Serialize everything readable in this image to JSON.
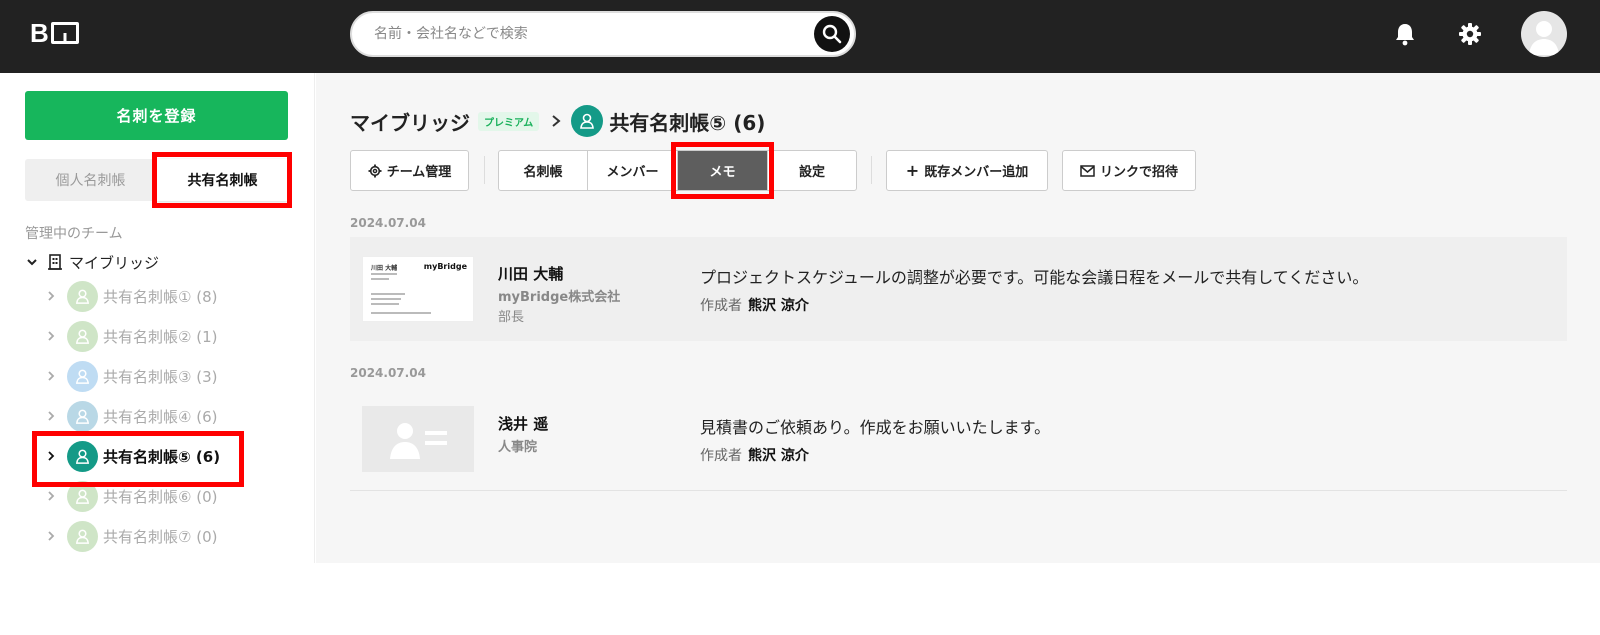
{
  "header": {
    "logo": "B",
    "search_placeholder": "名前・会社名などで検索"
  },
  "sidebar": {
    "register_label": "名刺を登録",
    "tabs": [
      {
        "label": "個人名刺帳",
        "active": false
      },
      {
        "label": "共有名刺帳",
        "active": true
      }
    ],
    "section_label": "管理中のチーム",
    "root_label": "マイブリッジ",
    "teams": [
      {
        "label": "共有名刺帳① (8)",
        "color": "#cfe5c7",
        "active": false
      },
      {
        "label": "共有名刺帳② (1)",
        "color": "#cfe5c7",
        "active": false
      },
      {
        "label": "共有名刺帳③ (3)",
        "color": "#bfdcf3",
        "active": false
      },
      {
        "label": "共有名刺帳④ (6)",
        "color": "#b9d8e6",
        "active": false
      },
      {
        "label": "共有名刺帳⑤ (6)",
        "color": "#149a87",
        "active": true
      },
      {
        "label": "共有名刺帳⑥ (0)",
        "color": "#cfe5c7",
        "active": false
      },
      {
        "label": "共有名刺帳⑦ (0)",
        "color": "#cfe5c7",
        "active": false
      }
    ]
  },
  "main": {
    "breadcrumb_root": "マイブリッジ",
    "premium_badge": "プレミアム",
    "breadcrumb_current": "共有名刺帳⑤ (6)",
    "team_manage_label": "チーム管理",
    "tabs": [
      {
        "label": "名刺帳",
        "active": false
      },
      {
        "label": "メンバー",
        "active": false
      },
      {
        "label": "メモ",
        "active": true
      },
      {
        "label": "設定",
        "active": false
      }
    ],
    "add_member_label": "既存メンバー追加",
    "invite_label": "リンクで招待",
    "memos": [
      {
        "date": "2024.07.04",
        "name": "川田 大輔",
        "company": "myBridge株式会社",
        "title": "部長",
        "text": "プロジェクトスケジュールの調整が必要です。可能な会議日程をメールで共有してください。",
        "author_label": "作成者",
        "author": "熊沢 涼介",
        "card_name": "川田 大輔",
        "card_brand": "myBridge"
      },
      {
        "date": "2024.07.04",
        "name": "浅井 遥",
        "company": "人事院",
        "title": "",
        "text": "見積書のご依頼あり。作成をお願いいたします。",
        "author_label": "作成者",
        "author": "熊沢 涼介"
      }
    ]
  }
}
